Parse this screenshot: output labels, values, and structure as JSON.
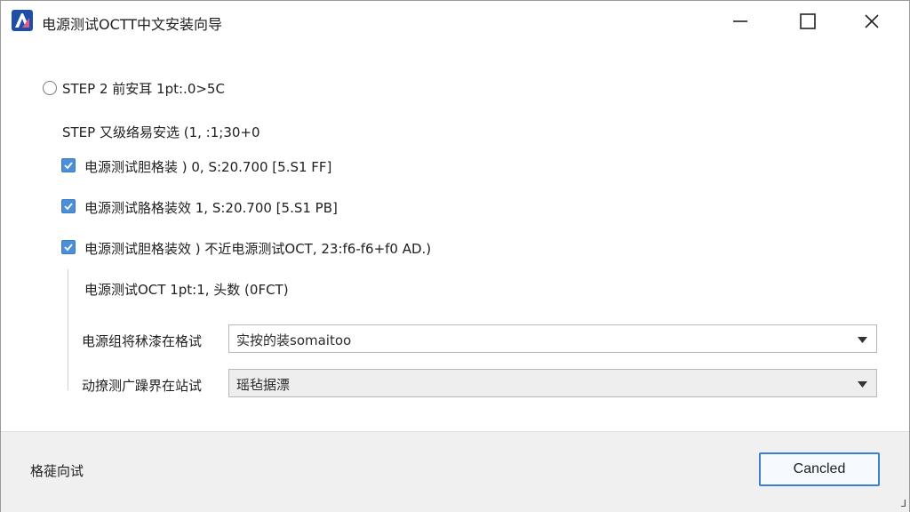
{
  "window": {
    "title": "电源测试OCTT中文安装向导",
    "colors": {
      "accent": "#4a8fd8",
      "footer_bg": "#f0f0f0",
      "button_border": "#3b7fd0"
    }
  },
  "content": {
    "step2_label": "STEP 2 前安耳 1pt:.0>5C",
    "step_header": "STEP 又级络易安选 (1, :1;30+0",
    "checkboxes": [
      {
        "label": "电源测试胆格装 ) 0, S:20.700 [5.S1 FF]",
        "checked": true
      },
      {
        "label": "电源测试胳格装效 1, S:20.700 [5.S1 PB]",
        "checked": true
      },
      {
        "label": "电源测试胆格装效 ) 不近电源测试OCT, 23:f6-f6+f0 AD.)",
        "checked": true
      }
    ],
    "sub_info": "电源测试OCT 1pt:1, 头数 (0FCT)",
    "fields": [
      {
        "label": "电源组将秫漆在格试",
        "value": "实按的装somaitoo"
      },
      {
        "label": "动撩测广躁界在站试",
        "value": "瑶毡据漂"
      }
    ]
  },
  "footer": {
    "status_text": "格蓰向试",
    "cancel_label": "Cancled"
  },
  "corner_glyph": "⅃"
}
